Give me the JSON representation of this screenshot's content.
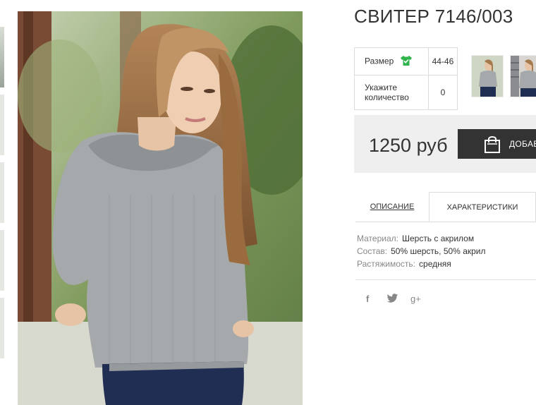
{
  "product": {
    "title": "СВИТЕР 7146/003",
    "options": {
      "size_label": "Размер",
      "size_value": "44-46",
      "qty_label_line1": "Укажите",
      "qty_label_line2": "количество",
      "qty_value": "0"
    },
    "price": "1250 руб",
    "buy_button_label": "ДОБАВ"
  },
  "tabs": [
    {
      "label": "ОПИСАНИЕ",
      "active": false
    },
    {
      "label": "ХАРАКТЕРИСТИКИ",
      "active": true
    }
  ],
  "specs": [
    {
      "key": "Материал:",
      "value": "Шерсть с акрилом"
    },
    {
      "key": "Состав:",
      "value": "50% шерсть, 50% акрил"
    },
    {
      "key": "Растяжимость:",
      "value": "средняя"
    }
  ],
  "social": {
    "facebook": "f",
    "google_plus": "g+"
  },
  "icons": [
    "shirt-check-icon",
    "shopping-bag-icon",
    "facebook-icon",
    "twitter-icon",
    "google-plus-icon"
  ],
  "colors": {
    "accent_green": "#2fb44c",
    "button_dark": "#333333",
    "price_bg": "#efefef"
  }
}
